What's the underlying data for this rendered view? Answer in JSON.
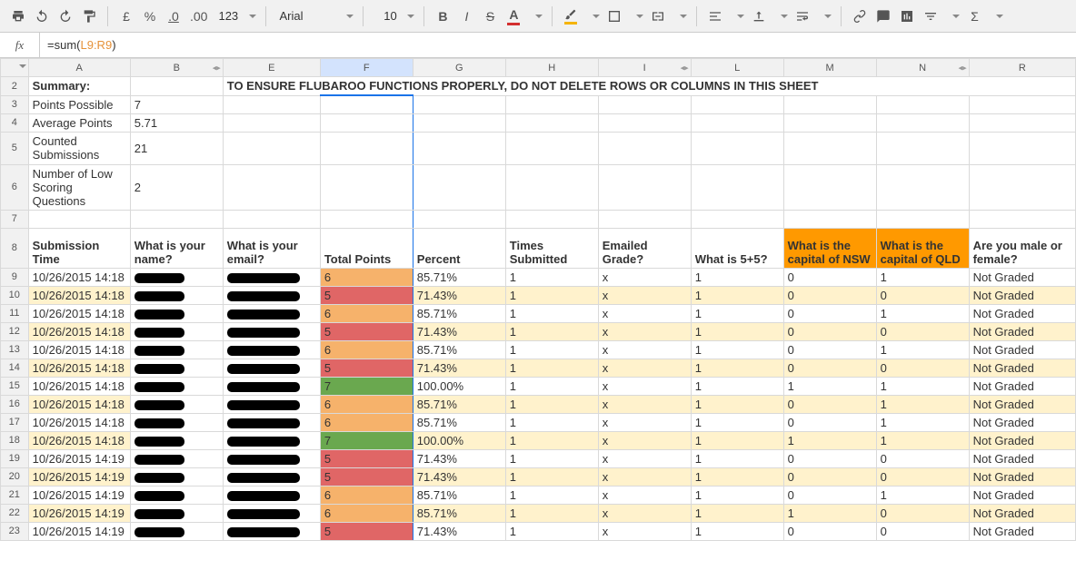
{
  "toolbar": {
    "currency_pound": "£",
    "percent": "%",
    "dec_dec": ".0",
    "dec_inc": ".00",
    "more_formats": "123",
    "font": "Arial",
    "size": "10",
    "bold": "B",
    "italic": "I",
    "strike": "S",
    "sigma": "Σ"
  },
  "formula": {
    "fx": "fx",
    "prefix": "=sum(",
    "ref": "L9:R9",
    "suffix": ")"
  },
  "columns": [
    "A",
    "B",
    "E",
    "F",
    "G",
    "H",
    "I",
    "L",
    "M",
    "N",
    "R"
  ],
  "summary": {
    "title": "Summary:",
    "warning": "TO ENSURE FLUBAROO FUNCTIONS PROPERLY, DO NOT DELETE ROWS OR COLUMNS IN THIS SHEET",
    "points_possible_label": "Points Possible",
    "points_possible": 7,
    "avg_points_label": "Average Points",
    "avg_points": 5.71,
    "counted_label": "Counted Submissions",
    "counted": 21,
    "low_label": "Number of Low Scoring Questions",
    "low": 2
  },
  "headers": {
    "submission_time": "Submission Time",
    "name": "What is your name?",
    "email": "What is your email?",
    "total_points": "Total Points",
    "percent": "Percent",
    "times_submitted": "Times Submitted",
    "emailed_grade": "Emailed Grade?",
    "q_5plus5": "What is 5+5?",
    "q_nsw": "What is the capital of NSW",
    "q_qld": "What is the capital of QLD",
    "q_gender": "Are you male or female?"
  },
  "rows": [
    {
      "n": 9,
      "alt": false,
      "time": "10/26/2015 14:18",
      "tp": 6,
      "tpc": "tp-orange",
      "pct": "85.71%",
      "ts": 1,
      "eg": "x",
      "q1": 1,
      "q2": 0,
      "q3": 1,
      "gen": "Not Graded"
    },
    {
      "n": 10,
      "alt": true,
      "time": "10/26/2015 14:18",
      "tp": 5,
      "tpc": "tp-red",
      "pct": "71.43%",
      "ts": 1,
      "eg": "x",
      "q1": 1,
      "q2": 0,
      "q3": 0,
      "gen": "Not Graded"
    },
    {
      "n": 11,
      "alt": false,
      "time": "10/26/2015 14:18",
      "tp": 6,
      "tpc": "tp-orange",
      "pct": "85.71%",
      "ts": 1,
      "eg": "x",
      "q1": 1,
      "q2": 0,
      "q3": 1,
      "gen": "Not Graded"
    },
    {
      "n": 12,
      "alt": true,
      "time": "10/26/2015 14:18",
      "tp": 5,
      "tpc": "tp-red",
      "pct": "71.43%",
      "ts": 1,
      "eg": "x",
      "q1": 1,
      "q2": 0,
      "q3": 0,
      "gen": "Not Graded"
    },
    {
      "n": 13,
      "alt": false,
      "time": "10/26/2015 14:18",
      "tp": 6,
      "tpc": "tp-orange",
      "pct": "85.71%",
      "ts": 1,
      "eg": "x",
      "q1": 1,
      "q2": 0,
      "q3": 1,
      "gen": "Not Graded"
    },
    {
      "n": 14,
      "alt": true,
      "time": "10/26/2015 14:18",
      "tp": 5,
      "tpc": "tp-red",
      "pct": "71.43%",
      "ts": 1,
      "eg": "x",
      "q1": 1,
      "q2": 0,
      "q3": 0,
      "gen": "Not Graded"
    },
    {
      "n": 15,
      "alt": false,
      "time": "10/26/2015 14:18",
      "tp": 7,
      "tpc": "tp-green",
      "pct": "100.00%",
      "ts": 1,
      "eg": "x",
      "q1": 1,
      "q2": 1,
      "q3": 1,
      "gen": "Not Graded"
    },
    {
      "n": 16,
      "alt": true,
      "time": "10/26/2015 14:18",
      "tp": 6,
      "tpc": "tp-orange",
      "pct": "85.71%",
      "ts": 1,
      "eg": "x",
      "q1": 1,
      "q2": 0,
      "q3": 1,
      "gen": "Not Graded"
    },
    {
      "n": 17,
      "alt": false,
      "time": "10/26/2015 14:18",
      "tp": 6,
      "tpc": "tp-orange",
      "pct": "85.71%",
      "ts": 1,
      "eg": "x",
      "q1": 1,
      "q2": 0,
      "q3": 1,
      "gen": "Not Graded"
    },
    {
      "n": 18,
      "alt": true,
      "time": "10/26/2015 14:18",
      "tp": 7,
      "tpc": "tp-green",
      "pct": "100.00%",
      "ts": 1,
      "eg": "x",
      "q1": 1,
      "q2": 1,
      "q3": 1,
      "gen": "Not Graded"
    },
    {
      "n": 19,
      "alt": false,
      "time": "10/26/2015 14:19",
      "tp": 5,
      "tpc": "tp-red",
      "pct": "71.43%",
      "ts": 1,
      "eg": "x",
      "q1": 1,
      "q2": 0,
      "q3": 0,
      "gen": "Not Graded"
    },
    {
      "n": 20,
      "alt": true,
      "time": "10/26/2015 14:19",
      "tp": 5,
      "tpc": "tp-red",
      "pct": "71.43%",
      "ts": 1,
      "eg": "x",
      "q1": 1,
      "q2": 0,
      "q3": 0,
      "gen": "Not Graded"
    },
    {
      "n": 21,
      "alt": false,
      "time": "10/26/2015 14:19",
      "tp": 6,
      "tpc": "tp-orange",
      "pct": "85.71%",
      "ts": 1,
      "eg": "x",
      "q1": 1,
      "q2": 0,
      "q3": 1,
      "gen": "Not Graded"
    },
    {
      "n": 22,
      "alt": true,
      "time": "10/26/2015 14:19",
      "tp": 6,
      "tpc": "tp-orange",
      "pct": "85.71%",
      "ts": 1,
      "eg": "x",
      "q1": 1,
      "q2": 1,
      "q3": 0,
      "gen": "Not Graded"
    },
    {
      "n": 23,
      "alt": false,
      "time": "10/26/2015 14:19",
      "tp": 5,
      "tpc": "tp-red",
      "pct": "71.43%",
      "ts": 1,
      "eg": "x",
      "q1": 1,
      "q2": 0,
      "q3": 0,
      "gen": "Not Graded"
    }
  ],
  "chart_data": {
    "type": "table",
    "title": "Flubaroo Grades",
    "columns": [
      "Submission Time",
      "Total Points",
      "Percent",
      "Times Submitted",
      "Emailed Grade?",
      "What is 5+5?",
      "What is the capital of NSW",
      "What is the capital of QLD",
      "Are you male or female?"
    ],
    "rows": [
      [
        "10/26/2015 14:18",
        6,
        "85.71%",
        1,
        "x",
        1,
        0,
        1,
        "Not Graded"
      ],
      [
        "10/26/2015 14:18",
        5,
        "71.43%",
        1,
        "x",
        1,
        0,
        0,
        "Not Graded"
      ],
      [
        "10/26/2015 14:18",
        6,
        "85.71%",
        1,
        "x",
        1,
        0,
        1,
        "Not Graded"
      ],
      [
        "10/26/2015 14:18",
        5,
        "71.43%",
        1,
        "x",
        1,
        0,
        0,
        "Not Graded"
      ],
      [
        "10/26/2015 14:18",
        6,
        "85.71%",
        1,
        "x",
        1,
        0,
        1,
        "Not Graded"
      ],
      [
        "10/26/2015 14:18",
        5,
        "71.43%",
        1,
        "x",
        1,
        0,
        0,
        "Not Graded"
      ],
      [
        "10/26/2015 14:18",
        7,
        "100.00%",
        1,
        "x",
        1,
        1,
        1,
        "Not Graded"
      ],
      [
        "10/26/2015 14:18",
        6,
        "85.71%",
        1,
        "x",
        1,
        0,
        1,
        "Not Graded"
      ],
      [
        "10/26/2015 14:18",
        6,
        "85.71%",
        1,
        "x",
        1,
        0,
        1,
        "Not Graded"
      ],
      [
        "10/26/2015 14:18",
        7,
        "100.00%",
        1,
        "x",
        1,
        1,
        1,
        "Not Graded"
      ],
      [
        "10/26/2015 14:19",
        5,
        "71.43%",
        1,
        "x",
        1,
        0,
        0,
        "Not Graded"
      ],
      [
        "10/26/2015 14:19",
        5,
        "71.43%",
        1,
        "x",
        1,
        0,
        0,
        "Not Graded"
      ],
      [
        "10/26/2015 14:19",
        6,
        "85.71%",
        1,
        "x",
        1,
        0,
        1,
        "Not Graded"
      ],
      [
        "10/26/2015 14:19",
        6,
        "85.71%",
        1,
        "x",
        1,
        1,
        0,
        "Not Graded"
      ],
      [
        "10/26/2015 14:19",
        5,
        "71.43%",
        1,
        "x",
        1,
        0,
        0,
        "Not Graded"
      ]
    ]
  }
}
